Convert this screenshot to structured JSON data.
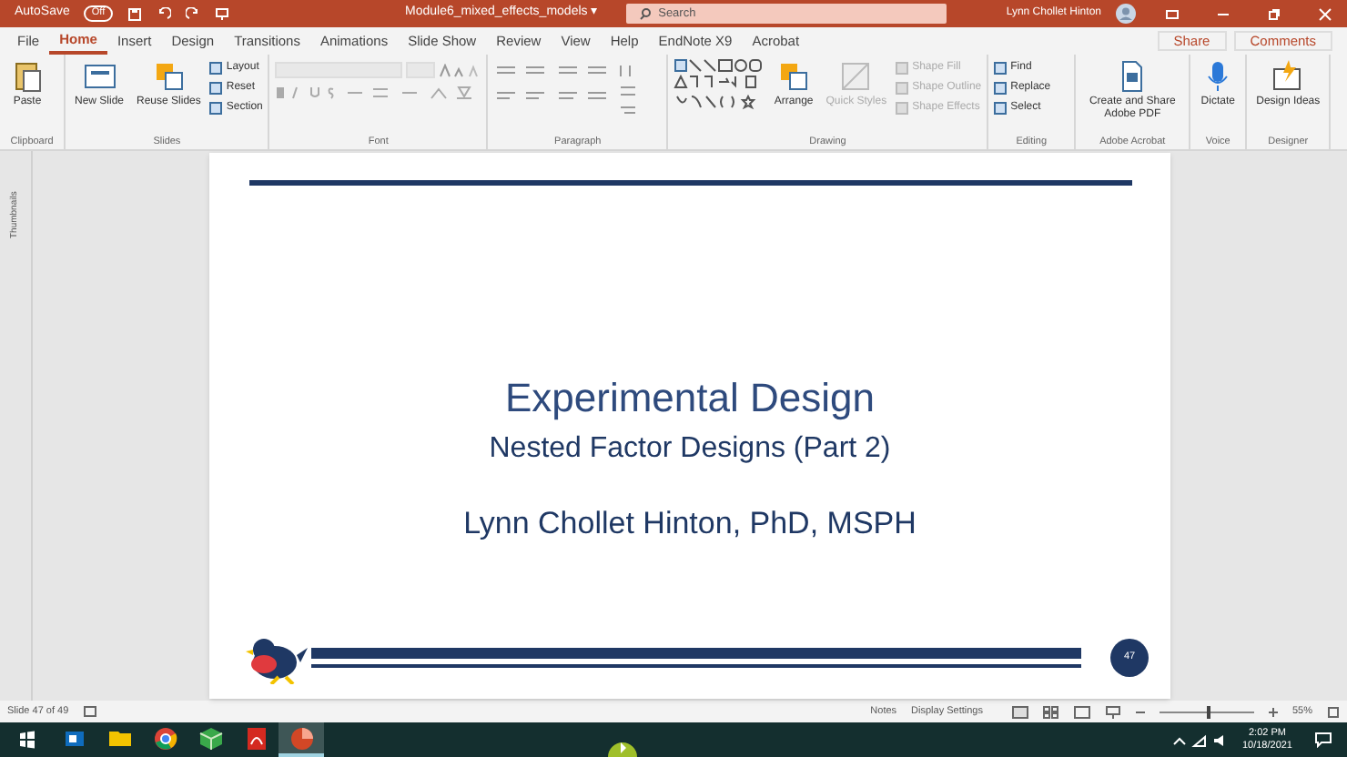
{
  "title_bar": {
    "autosave_label": "AutoSave",
    "autosave_state": "Off",
    "autosave_on": false,
    "file_name": "Module6_mixed_effects_models ▾",
    "search_placeholder": "Search",
    "user": "Lynn Chollet Hinton"
  },
  "tabs": [
    {
      "label": "File",
      "selected": false
    },
    {
      "label": "Home",
      "selected": true
    },
    {
      "label": "Insert",
      "selected": false
    },
    {
      "label": "Design",
      "selected": false
    },
    {
      "label": "Transitions",
      "selected": false
    },
    {
      "label": "Animations",
      "selected": false
    },
    {
      "label": "Slide Show",
      "selected": false
    },
    {
      "label": "Review",
      "selected": false
    },
    {
      "label": "View",
      "selected": false
    },
    {
      "label": "Help",
      "selected": false
    },
    {
      "label": "EndNote X9",
      "selected": false
    },
    {
      "label": "Acrobat",
      "selected": false
    }
  ],
  "share": "Share",
  "comments": "Comments",
  "ribbon": [
    {
      "label": "Clipboard",
      "kind": "buttons",
      "items": [
        {
          "label": "Paste",
          "kind": "large",
          "disabled": false
        }
      ]
    },
    {
      "label": "Slides",
      "kind": "buttons",
      "items": [
        {
          "label": "New Slide",
          "kind": "large",
          "disabled": false
        },
        {
          "label": "Reuse Slides",
          "kind": "large",
          "disabled": false
        },
        {
          "label": "Layout",
          "kind": "small",
          "disabled": false
        },
        {
          "label": "Reset",
          "kind": "small",
          "disabled": false
        },
        {
          "label": "Section",
          "kind": "small",
          "disabled": false
        }
      ]
    },
    {
      "label": "Font",
      "kind": "font"
    },
    {
      "label": "Paragraph",
      "kind": "paragraph"
    },
    {
      "label": "Drawing",
      "kind": "drawing",
      "items": [
        {
          "label": "Arrange",
          "kind": "large",
          "disabled": false
        },
        {
          "label": "Quick Styles",
          "kind": "large",
          "disabled": true
        },
        {
          "label": "Shape Fill",
          "kind": "small",
          "disabled": true
        },
        {
          "label": "Shape Outline",
          "kind": "small",
          "disabled": true
        },
        {
          "label": "Shape Effects",
          "kind": "small",
          "disabled": true
        }
      ]
    },
    {
      "label": "Editing",
      "kind": "buttons",
      "items": [
        {
          "label": "Find",
          "kind": "small",
          "disabled": false
        },
        {
          "label": "Replace",
          "kind": "small",
          "disabled": false
        },
        {
          "label": "Select",
          "kind": "small",
          "disabled": false
        }
      ]
    },
    {
      "label": "Adobe Acrobat",
      "kind": "buttons",
      "items": [
        {
          "label": "Create and Share Adobe PDF",
          "kind": "large",
          "disabled": false
        }
      ]
    },
    {
      "label": "Voice",
      "kind": "buttons",
      "items": [
        {
          "label": "Dictate",
          "kind": "large",
          "disabled": false
        }
      ]
    },
    {
      "label": "Designer",
      "kind": "buttons",
      "items": [
        {
          "label": "Design Ideas",
          "kind": "large",
          "disabled": false
        }
      ]
    }
  ],
  "thumbnails_label": "Thumbnails",
  "slide": {
    "title": "Experimental Design",
    "subtitle": "Nested Factor Designs (Part 2)",
    "author": "Lynn Chollet Hinton, PhD, MSPH",
    "slide_number": "47"
  },
  "status_bar": {
    "slide_count": "Slide 47 of 49",
    "notes": "Notes",
    "display_settings": "Display Settings",
    "zoom": "55%",
    "zoom_slider": {
      "level": 0.5
    }
  },
  "taskbar": {
    "apps": [
      {
        "selected": false
      },
      {
        "selected": false
      },
      {
        "selected": false
      },
      {
        "selected": false
      },
      {
        "selected": false
      },
      {
        "selected": true
      }
    ],
    "time": "2:02 PM",
    "date": "10/18/2021"
  }
}
